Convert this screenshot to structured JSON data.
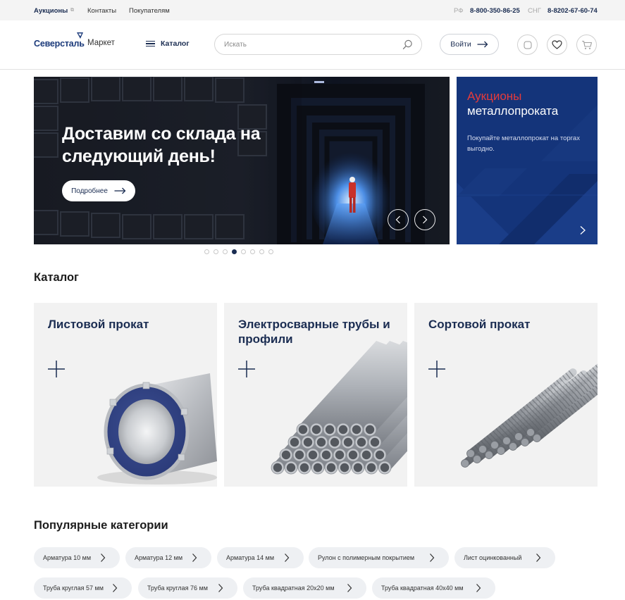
{
  "topbar": {
    "auctions": "Аукционы",
    "contacts": "Контакты",
    "buyers": "Покупателям",
    "rf_label": "РФ",
    "rf_phone": "8-800-350-86-25",
    "cis_label": "СНГ",
    "cis_phone": "8-8202-67-60-74"
  },
  "header": {
    "brand": "Северсталь",
    "market": "Маркет",
    "catalog": "Каталог",
    "search_placeholder": "Искать",
    "login": "Войти",
    "accent_color": "#1b2d52"
  },
  "hero": {
    "title": "Доставим со склада на следующий день!",
    "more": "Подробнее",
    "slides_total": 8,
    "active_slide": 4
  },
  "promo": {
    "title_red": "Аукционы",
    "title_white": "металлопроката",
    "text": "Покупайте металлопрокат на торгах выгодно.",
    "background": "#14347a"
  },
  "catalog": {
    "title": "Каталог",
    "cards": [
      {
        "title": "Листовой прокат"
      },
      {
        "title": "Электросварные трубы и профили"
      },
      {
        "title": "Сортовой прокат"
      }
    ]
  },
  "popular": {
    "title": "Популярные категории",
    "chips": [
      "Арматура 10 мм",
      "Арматура 12 мм",
      "Арматура 14 мм",
      "Рулон с полимерным покрытием",
      "Лист оцинкованный",
      "Труба круглая 57 мм",
      "Труба круглая 76 мм",
      "Труба квадратная 20х20 мм",
      "Труба квадратная 40х40 мм"
    ]
  }
}
